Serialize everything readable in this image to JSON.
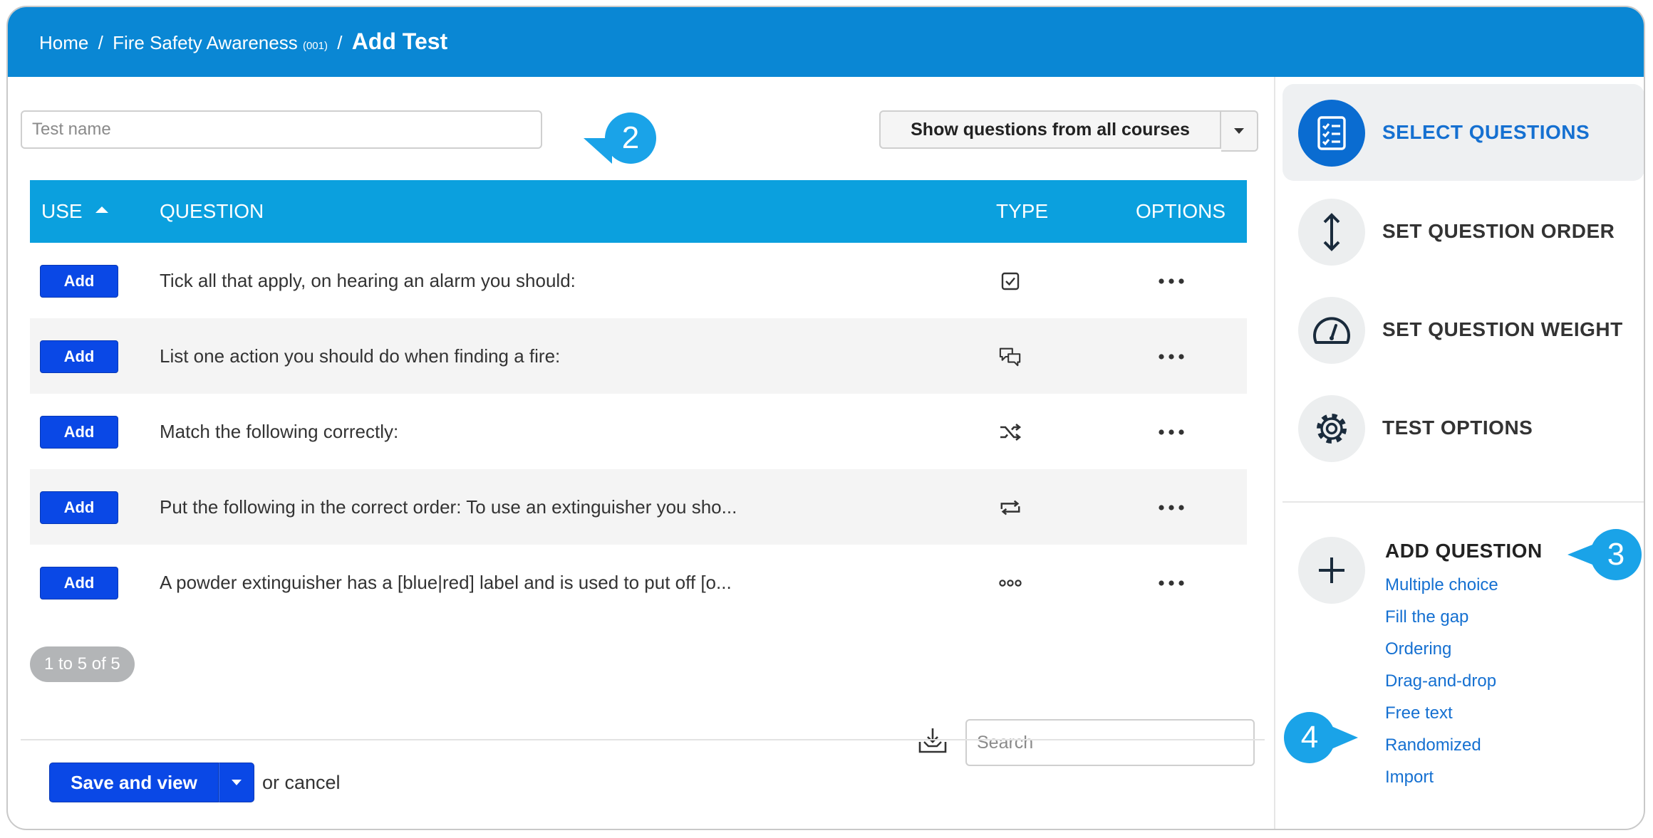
{
  "breadcrumb": {
    "home": "Home",
    "sep": "/",
    "course": "Fire Safety Awareness",
    "course_code": "(001)",
    "current": "Add Test"
  },
  "test_name": {
    "placeholder": "Test name",
    "value": ""
  },
  "filter": {
    "label": "Show questions from all courses"
  },
  "table": {
    "headers": {
      "use": "USE",
      "question": "QUESTION",
      "type": "TYPE",
      "options": "OPTIONS"
    },
    "rows": [
      {
        "add": "Add",
        "question": "Tick all that apply, on hearing an alarm you should:",
        "type_icon": "checkbox-icon",
        "options_icon": "more-icon"
      },
      {
        "add": "Add",
        "question": "List one action you should do when finding a fire:",
        "type_icon": "chat-bubbles-icon",
        "options_icon": "more-icon"
      },
      {
        "add": "Add",
        "question": "Match the following correctly:",
        "type_icon": "shuffle-icon",
        "options_icon": "more-icon"
      },
      {
        "add": "Add",
        "question": "Put the following in the correct order: To use an extinguisher you sho...",
        "type_icon": "repeat-icon",
        "options_icon": "more-icon"
      },
      {
        "add": "Add",
        "question": "A powder extinguisher has a [blue|red] label and is used to put off [o...",
        "type_icon": "fill-gap-icon",
        "options_icon": "more-icon"
      }
    ]
  },
  "pager": {
    "text": "1 to 5 of 5"
  },
  "search": {
    "placeholder": "Search"
  },
  "footer": {
    "save_label": "Save and view",
    "or_cancel": "or cancel"
  },
  "steps": [
    {
      "label": "SELECT QUESTIONS",
      "icon": "checklist-icon",
      "active": true
    },
    {
      "label": "SET QUESTION ORDER",
      "icon": "vertical-arrows-icon",
      "active": false
    },
    {
      "label": "SET QUESTION WEIGHT",
      "icon": "gauge-icon",
      "active": false
    },
    {
      "label": "TEST OPTIONS",
      "icon": "gear-icon",
      "active": false
    }
  ],
  "add_question": {
    "title": "ADD QUESTION",
    "types": [
      "Multiple choice",
      "Fill the gap",
      "Ordering",
      "Drag-and-drop",
      "Free text",
      "Randomized",
      "Import"
    ]
  },
  "callouts": [
    "2",
    "3",
    "4"
  ],
  "colors": {
    "header": "#0a87d4",
    "table_header": "#0ba0de",
    "button": "#0a48e6",
    "link": "#1570d1",
    "callout": "#1aa3e8"
  }
}
